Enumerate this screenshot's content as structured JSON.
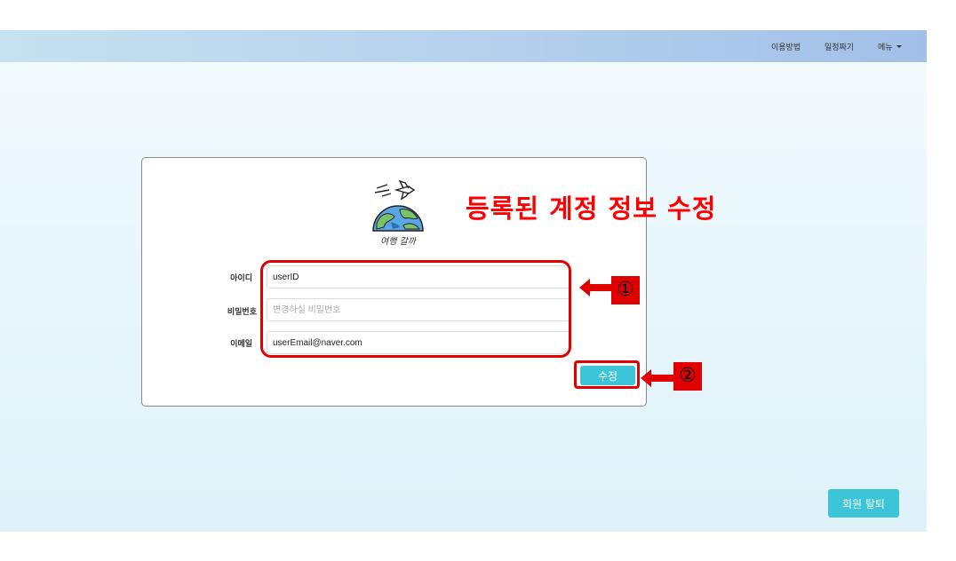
{
  "navbar": {
    "items": [
      {
        "label": "이용방법"
      },
      {
        "label": "일정짜기"
      },
      {
        "label": "메뉴"
      }
    ]
  },
  "logo": {
    "caption": "여행 갈까"
  },
  "form": {
    "fields": [
      {
        "label": "아이디",
        "value": "userID",
        "placeholder": ""
      },
      {
        "label": "비밀번호",
        "value": "",
        "placeholder": "변경하실 비밀번호"
      },
      {
        "label": "이메일",
        "value": "userEmail@naver.com",
        "placeholder": ""
      }
    ],
    "submit_label": "수정"
  },
  "annotations": {
    "title": "등록된 계정 정보 수정",
    "marker1": "①",
    "marker2": "②",
    "color": "#e00000"
  },
  "footer": {
    "withdraw_label": "회원 탈퇴"
  },
  "colors": {
    "accent": "#3cc4d8",
    "navbar_start": "#c5e2f0",
    "navbar_end": "#a2bfe8"
  }
}
